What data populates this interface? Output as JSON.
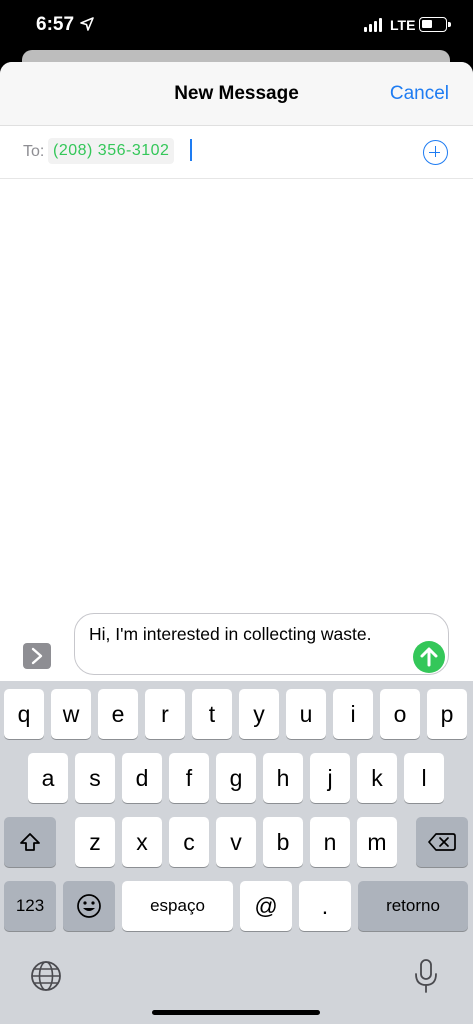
{
  "status_bar": {
    "time": "6:57",
    "network": "LTE"
  },
  "nav": {
    "title": "New Message",
    "cancel_label": "Cancel"
  },
  "to_field": {
    "label": "To:",
    "recipient": "(208) 356-3102"
  },
  "compose": {
    "text": "Hi, I'm interested in collecting waste."
  },
  "keyboard": {
    "row1": [
      "q",
      "w",
      "e",
      "r",
      "t",
      "y",
      "u",
      "i",
      "o",
      "p"
    ],
    "row2": [
      "a",
      "s",
      "d",
      "f",
      "g",
      "h",
      "j",
      "k",
      "l"
    ],
    "row3": [
      "z",
      "x",
      "c",
      "v",
      "b",
      "n",
      "m"
    ],
    "numbers_label": "123",
    "space_label": "espaço",
    "at_label": "@",
    "dot_label": ".",
    "return_label": "retorno"
  },
  "icons": {
    "location": "location-arrow-icon",
    "add_contact": "plus-circle-icon",
    "apps": "chevron-right-icon",
    "send": "arrow-up-icon",
    "shift": "shift-icon",
    "delete": "backspace-icon",
    "emoji": "emoji-icon",
    "globe": "globe-icon",
    "mic": "microphone-icon"
  },
  "colors": {
    "accent": "#1e7cf2",
    "imessage_green": "#34c759"
  }
}
